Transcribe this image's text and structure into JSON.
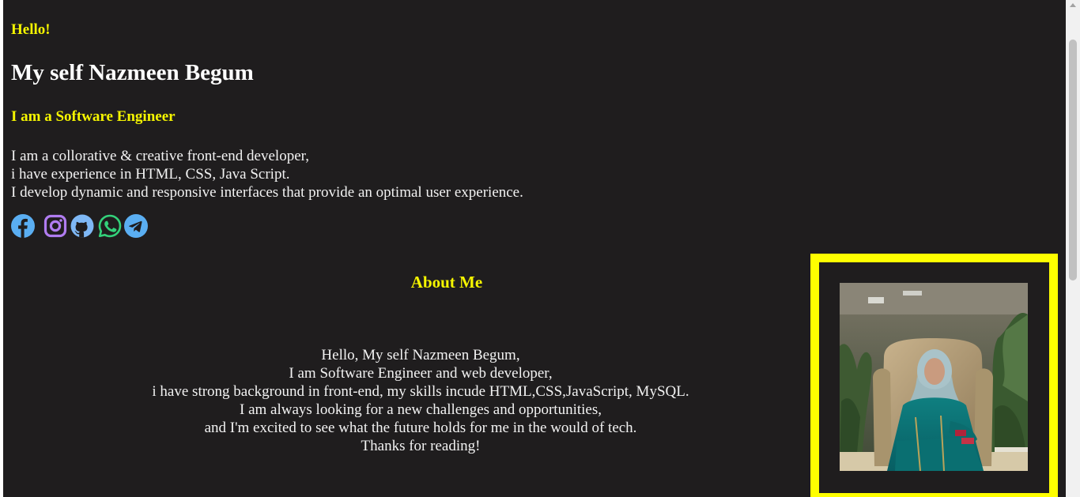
{
  "hero": {
    "greeting": "Hello!",
    "name_line": "My self Nazmeen Begum",
    "role": "I am a Software Engineer",
    "intro_lines": [
      "I am a collorative & creative front-end developer,",
      "i have experience in HTML, CSS, Java Script.",
      "I develop dynamic and responsive interfaces that provide an optimal user experience."
    ]
  },
  "socials": [
    {
      "icon": "facebook-icon",
      "color": "#5aaef2"
    },
    {
      "icon": "instagram-icon",
      "color": "#b07cf0"
    },
    {
      "icon": "github-icon",
      "color": "#7fb8f5"
    },
    {
      "icon": "whatsapp-icon",
      "color": "#33d17a"
    },
    {
      "icon": "telegram-icon",
      "color": "#5aaef2"
    }
  ],
  "about": {
    "title": "About Me",
    "lines": [
      "Hello, My self Nazmeen Begum,",
      "I am Software Engineer and web developer,",
      "i have strong background in front-end, my skills incude HTML,CSS,JavaScript, MySQL.",
      "I am always looking for a new challenges and opportunities,",
      "and I'm excited to see what the future holds for me in the would of tech.",
      "Thanks for reading!"
    ]
  },
  "colors": {
    "background": "#1f1d1e",
    "accent": "#f5f500",
    "frame": "#ffff00",
    "text": "#f2f2f2"
  }
}
